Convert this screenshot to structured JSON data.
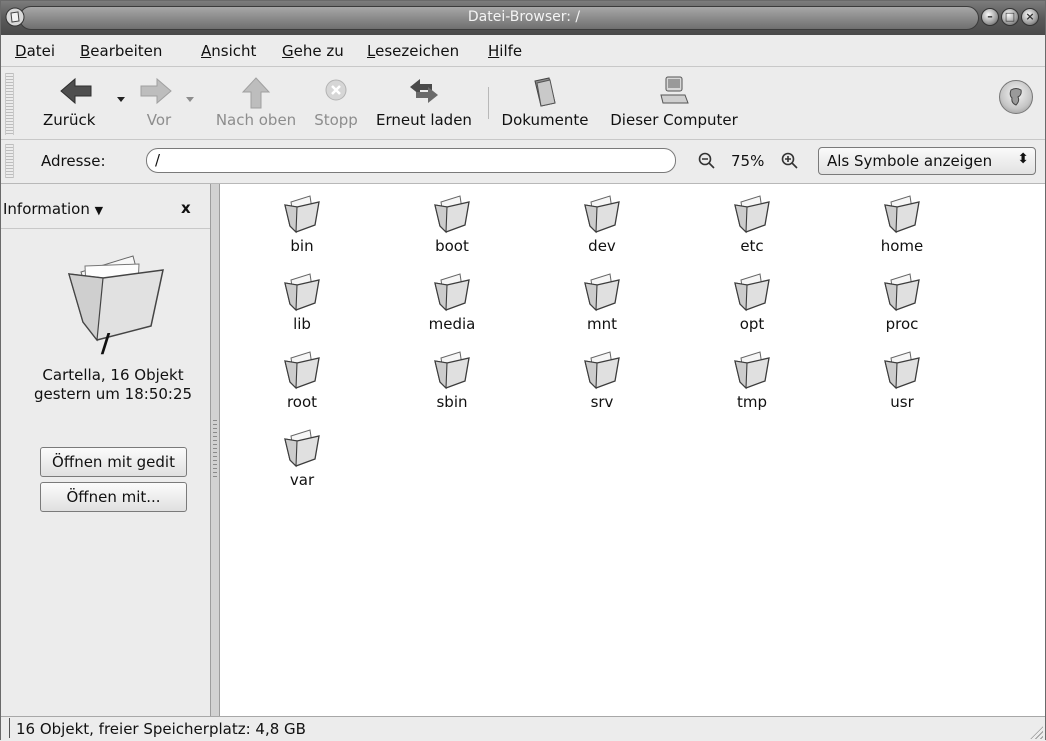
{
  "window": {
    "title": "Datei-Browser: /"
  },
  "menubar": {
    "items": [
      {
        "accel": "D",
        "rest": "atei"
      },
      {
        "accel": "B",
        "rest": "earbeiten"
      },
      {
        "accel": "A",
        "rest": "nsicht"
      },
      {
        "accel": "G",
        "rest": "ehe zu"
      },
      {
        "accel": "L",
        "rest": "esezeichen"
      },
      {
        "accel": "H",
        "rest": "ilfe"
      }
    ]
  },
  "toolbar": {
    "back": "Zurück",
    "forward": "Vor",
    "up": "Nach oben",
    "stop": "Stopp",
    "reload": "Erneut laden",
    "documents": "Dokumente",
    "computer": "Dieser Computer"
  },
  "location": {
    "label": "Adresse:",
    "value": "/",
    "zoom_level": "75%",
    "view_mode": "Als Symbole anzeigen"
  },
  "sidepane": {
    "title": "Information",
    "close": "x",
    "folder_name": "/",
    "info_line1": "Cartella, 16 Objekt",
    "info_line2": "gestern um 18:50:25",
    "open_with_gedit": "Öffnen mit gedit",
    "open_with": "Öffnen mit..."
  },
  "files": [
    "bin",
    "boot",
    "dev",
    "etc",
    "home",
    "lib",
    "media",
    "mnt",
    "opt",
    "proc",
    "root",
    "sbin",
    "srv",
    "tmp",
    "usr",
    "var"
  ],
  "status": {
    "text": "16 Objekt, freier Speicherplatz: 4,8 GB"
  },
  "icons": [
    "folder-icon",
    "back-arrow-icon",
    "forward-arrow-icon",
    "up-arrow-icon",
    "stop-icon",
    "reload-icon",
    "documents-icon",
    "computer-icon",
    "zoom-out-icon",
    "zoom-in-icon",
    "throbber-icon"
  ]
}
